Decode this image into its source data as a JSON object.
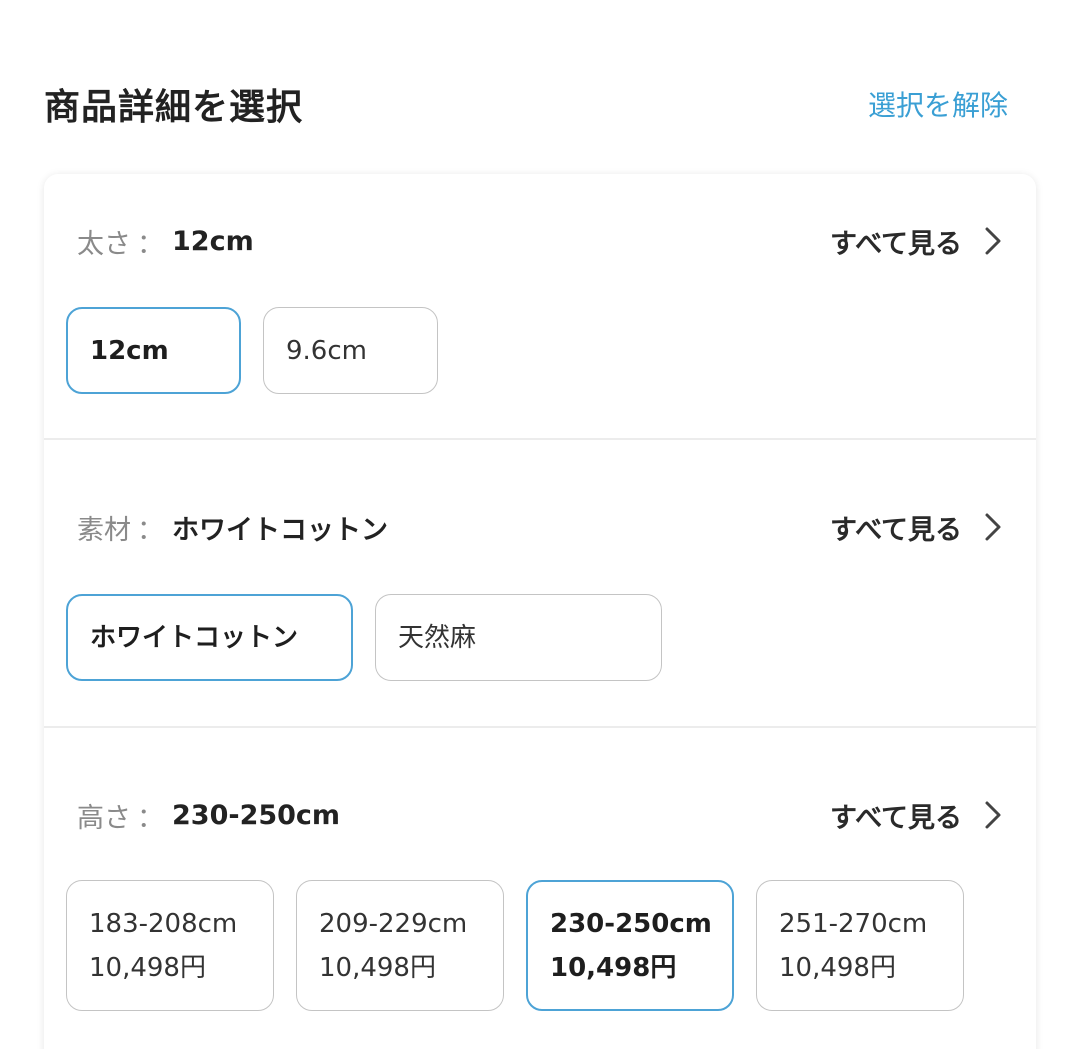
{
  "header": {
    "title": "商品詳細を選択",
    "clear_label": "選択を解除"
  },
  "sections": [
    {
      "key": "太さ",
      "colon": "：",
      "selected_value": "12cm",
      "see_all": "すべて見る",
      "options": [
        {
          "label": "12cm",
          "selected": true
        },
        {
          "label": "9.6cm",
          "selected": false
        }
      ]
    },
    {
      "key": "素材",
      "colon": "：",
      "selected_value": "ホワイトコットン",
      "see_all": "すべて見る",
      "options": [
        {
          "label": "ホワイトコットン",
          "selected": true
        },
        {
          "label": "天然麻",
          "selected": false
        }
      ]
    },
    {
      "key": "高さ",
      "colon": "：",
      "selected_value": "230-250cm",
      "see_all": "すべて見る",
      "options": [
        {
          "label": "183-208cm",
          "price": "10,498円",
          "selected": false
        },
        {
          "label": "209-229cm",
          "price": "10,498円",
          "selected": false
        },
        {
          "label": "230-250cm",
          "price": "10,498円",
          "selected": true
        },
        {
          "label": "251-270cm",
          "price": "10,498円",
          "selected": false
        }
      ]
    }
  ],
  "colors": {
    "accent": "#3a9fd4",
    "selected_border": "#4da3d6",
    "chip_border": "#c4c4c4"
  }
}
